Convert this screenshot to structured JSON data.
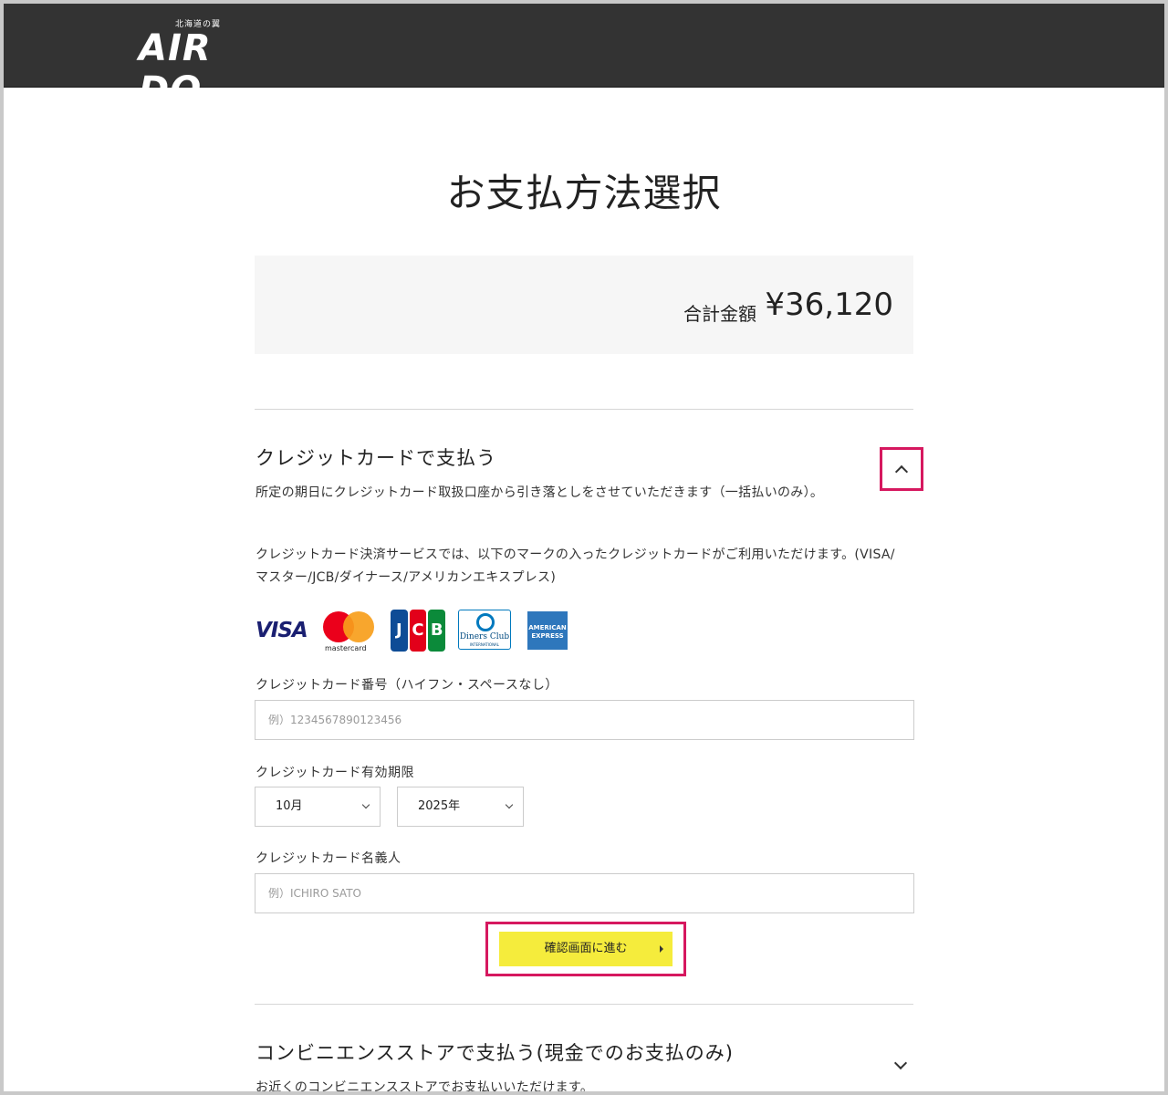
{
  "header": {
    "logo_sub": "北海道の翼",
    "logo_main": "AIR DO"
  },
  "page": {
    "title": "お支払方法選択"
  },
  "total": {
    "label": "合計金額",
    "value": "¥36,120"
  },
  "credit": {
    "title": "クレジットカードで支払う",
    "description": "所定の期日にクレジットカード取扱口座から引き落としをさせていただきます（一括払いのみ）。",
    "service_note_line1": "クレジットカード決済サービスでは、以下のマークの入ったクレジットカードがご利用いただけます。(VISA/",
    "service_note_line2": "マスター/JCB/ダイナース/アメリカンエキスプレス)",
    "brands": {
      "visa": "VISA",
      "mastercard": "mastercard",
      "jcb": [
        "J",
        "C",
        "B"
      ],
      "diners": "Diners Club",
      "diners_sub": "INTERNATIONAL",
      "amex_line1": "AMERICAN",
      "amex_line2": "EXPRESS"
    },
    "card_number_label": "クレジットカード番号（ハイフン・スペースなし）",
    "card_number_placeholder": "例）1234567890123456",
    "expiry_label": "クレジットカード有効期限",
    "expiry_month": "10月",
    "expiry_year": "2025年",
    "holder_label": "クレジットカード名義人",
    "holder_placeholder": "例）ICHIRO SATO",
    "submit_label": "確認画面に進む"
  },
  "convenience": {
    "title": "コンビニエンスストアで支払う(現金でのお支払のみ)",
    "description": "お近くのコンビニエンスストアでお支払いいただけます。"
  },
  "colors": {
    "header_bg": "#333333",
    "highlight": "#d6185f",
    "button": "#f5ec3c"
  }
}
